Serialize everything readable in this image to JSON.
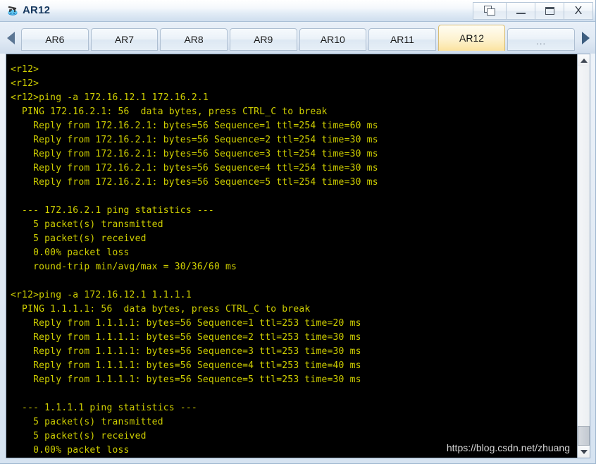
{
  "window": {
    "title": "AR12",
    "icon": "router-device-icon",
    "controls": [
      {
        "name": "restore-button",
        "label": "",
        "icon": "restore-windows-icon"
      },
      {
        "name": "minimize-button",
        "label": "",
        "icon": "minimize-icon"
      },
      {
        "name": "maximize-button",
        "label": "",
        "icon": "maximize-icon"
      },
      {
        "name": "close-button",
        "label": "X",
        "icon": "close-icon"
      }
    ]
  },
  "tab_bar": {
    "scroll_left_icon": "chevron-left-icon",
    "scroll_right_icon": "chevron-right-icon",
    "active_tab": "AR12",
    "tabs": [
      {
        "label": "AR6",
        "active": false
      },
      {
        "label": "AR7",
        "active": false
      },
      {
        "label": "AR8",
        "active": false
      },
      {
        "label": "AR9",
        "active": false
      },
      {
        "label": "AR10",
        "active": false
      },
      {
        "label": "AR11",
        "active": false
      },
      {
        "label": "AR12",
        "active": true
      },
      {
        "label": "...",
        "active": false
      }
    ]
  },
  "console": {
    "text_color": "#cfcf00",
    "background_color": "#000000",
    "lines": [
      "<r12>",
      "<r12>",
      "<r12>ping -a 172.16.12.1 172.16.2.1",
      "  PING 172.16.2.1: 56  data bytes, press CTRL_C to break",
      "    Reply from 172.16.2.1: bytes=56 Sequence=1 ttl=254 time=60 ms",
      "    Reply from 172.16.2.1: bytes=56 Sequence=2 ttl=254 time=30 ms",
      "    Reply from 172.16.2.1: bytes=56 Sequence=3 ttl=254 time=30 ms",
      "    Reply from 172.16.2.1: bytes=56 Sequence=4 ttl=254 time=30 ms",
      "    Reply from 172.16.2.1: bytes=56 Sequence=5 ttl=254 time=30 ms",
      "",
      "  --- 172.16.2.1 ping statistics ---",
      "    5 packet(s) transmitted",
      "    5 packet(s) received",
      "    0.00% packet loss",
      "    round-trip min/avg/max = 30/36/60 ms",
      "",
      "<r12>ping -a 172.16.12.1 1.1.1.1",
      "  PING 1.1.1.1: 56  data bytes, press CTRL_C to break",
      "    Reply from 1.1.1.1: bytes=56 Sequence=1 ttl=253 time=20 ms",
      "    Reply from 1.1.1.1: bytes=56 Sequence=2 ttl=253 time=30 ms",
      "    Reply from 1.1.1.1: bytes=56 Sequence=3 ttl=253 time=30 ms",
      "    Reply from 1.1.1.1: bytes=56 Sequence=4 ttl=253 time=40 ms",
      "    Reply from 1.1.1.1: bytes=56 Sequence=5 ttl=253 time=30 ms",
      "",
      "  --- 1.1.1.1 ping statistics ---",
      "    5 packet(s) transmitted",
      "    5 packet(s) received",
      "    0.00% packet loss"
    ],
    "scrollbar": {
      "up_icon": "chevron-up-icon",
      "down_icon": "chevron-down-icon"
    }
  },
  "watermark": {
    "text": "https://blog.csdn.net/zhuang"
  }
}
